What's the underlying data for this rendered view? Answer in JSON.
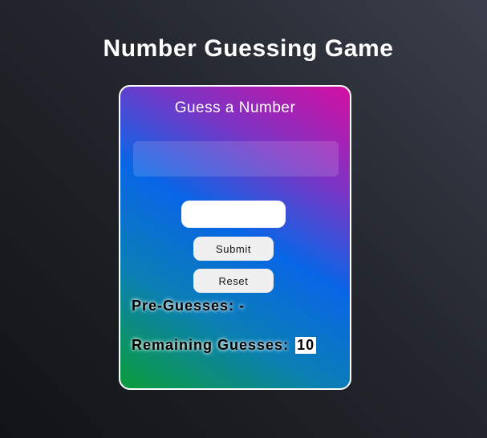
{
  "page": {
    "title": "Number Guessing Game"
  },
  "card": {
    "title": "Guess a Number",
    "message": "",
    "input": {
      "value": "",
      "placeholder": ""
    },
    "submit_label": "Submit",
    "reset_label": "Reset",
    "pre_guesses_label": "Pre-Guesses:",
    "pre_guesses_value": "-",
    "remaining_label": "Remaining Guesses:",
    "remaining_value": "10"
  }
}
